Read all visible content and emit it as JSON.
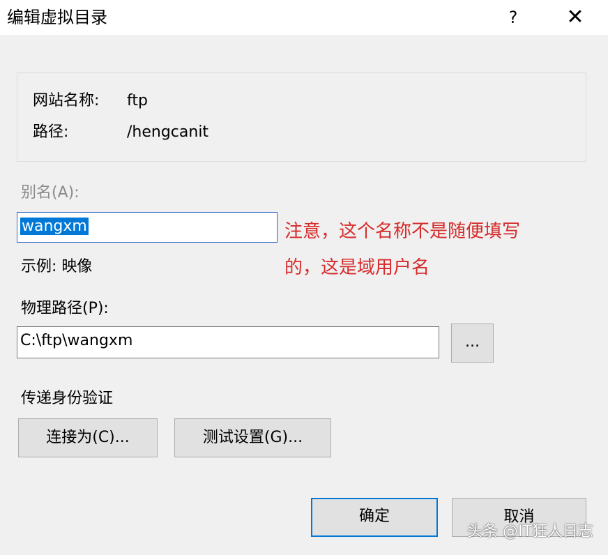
{
  "window": {
    "title": "编辑虚拟目录",
    "help_glyph": "?",
    "close_glyph": "✕"
  },
  "info": {
    "site_label": "网站名称:",
    "site_value": "ftp",
    "path_label": "路径:",
    "path_value": "/hengcanit"
  },
  "alias": {
    "label": "别名(A):",
    "value": "wangxm",
    "example": "示例: 映像"
  },
  "physical_path": {
    "label": "物理路径(P):",
    "value": "C:\\ftp\\wangxm",
    "browse_label": "..."
  },
  "auth": {
    "label": "传递身份验证",
    "connect_as_label": "连接为(C)...",
    "test_settings_label": "测试设置(G)..."
  },
  "buttons": {
    "ok_label": "确定",
    "cancel_label": "取消"
  },
  "annotation": {
    "line1": "注意，这个名称不是随便填写",
    "line2": "的，这是域用户名",
    "color": "#d62b2b"
  },
  "watermark": {
    "text": "头条 @IT狂人日志"
  }
}
